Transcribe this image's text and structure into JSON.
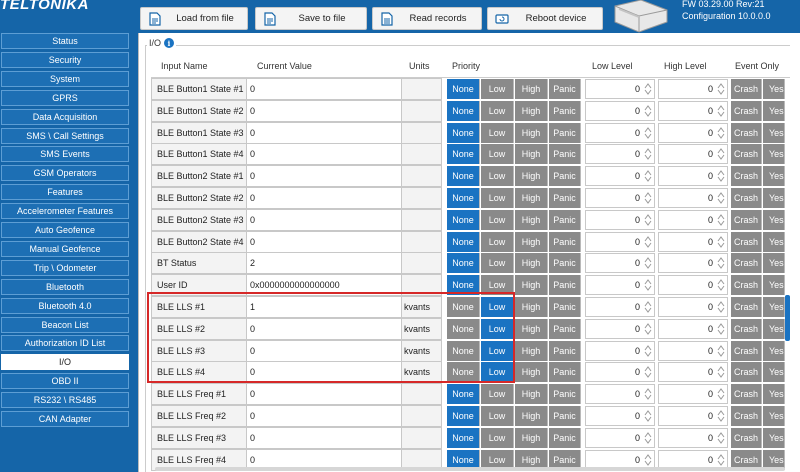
{
  "app": {
    "logo": "TELTONIKA",
    "fw_line": "FW  03.29.00 Rev:21",
    "config_line": "Configuration  10.0.0.0"
  },
  "toolbar": {
    "load_label": "Load from file",
    "save_label": "Save to file",
    "read_label": "Read records",
    "reboot_label": "Reboot device"
  },
  "sidebar": {
    "items": [
      "Status",
      "Security",
      "System",
      "GPRS",
      "Data Acquisition",
      "SMS \\ Call Settings",
      "SMS Events",
      "GSM Operators",
      "Features",
      "Accelerometer Features",
      "Auto Geofence",
      "Manual Geofence",
      "Trip \\ Odometer",
      "Bluetooth",
      "Bluetooth 4.0",
      "Beacon List",
      "Authorization ID List",
      "I/O",
      "OBD II",
      "RS232 \\ RS485",
      "CAN Adapter"
    ],
    "active_index": 17
  },
  "section": {
    "title": "I/O"
  },
  "table": {
    "headers": {
      "input_name": "Input Name",
      "current_value": "Current Value",
      "units": "Units",
      "priority": "Priority",
      "low_level": "Low Level",
      "high_level": "High Level",
      "event_only": "Event Only"
    },
    "priority_options": [
      "None",
      "Low",
      "High",
      "Panic"
    ],
    "event_options": [
      "Crash",
      "Yes"
    ],
    "rows": [
      {
        "name": "BLE Button1 State #1",
        "value": "0",
        "units": "",
        "priority": "None",
        "low": "0",
        "high": "0"
      },
      {
        "name": "BLE Button1 State #2",
        "value": "0",
        "units": "",
        "priority": "None",
        "low": "0",
        "high": "0"
      },
      {
        "name": "BLE Button1 State #3",
        "value": "0",
        "units": "",
        "priority": "None",
        "low": "0",
        "high": "0"
      },
      {
        "name": "BLE Button1 State #4",
        "value": "0",
        "units": "",
        "priority": "None",
        "low": "0",
        "high": "0"
      },
      {
        "name": "BLE Button2 State #1",
        "value": "0",
        "units": "",
        "priority": "None",
        "low": "0",
        "high": "0"
      },
      {
        "name": "BLE Button2 State #2",
        "value": "0",
        "units": "",
        "priority": "None",
        "low": "0",
        "high": "0"
      },
      {
        "name": "BLE Button2 State #3",
        "value": "0",
        "units": "",
        "priority": "None",
        "low": "0",
        "high": "0"
      },
      {
        "name": "BLE Button2 State #4",
        "value": "0",
        "units": "",
        "priority": "None",
        "low": "0",
        "high": "0"
      },
      {
        "name": "BT Status",
        "value": "2",
        "units": "",
        "priority": "None",
        "low": "0",
        "high": "0"
      },
      {
        "name": "User ID",
        "value": "0x0000000000000000",
        "units": "",
        "priority": "None",
        "low": "0",
        "high": "0"
      },
      {
        "name": "BLE LLS #1",
        "value": "1",
        "units": "kvants",
        "priority": "Low",
        "low": "0",
        "high": "0"
      },
      {
        "name": "BLE LLS #2",
        "value": "0",
        "units": "kvants",
        "priority": "Low",
        "low": "0",
        "high": "0"
      },
      {
        "name": "BLE LLS #3",
        "value": "0",
        "units": "kvants",
        "priority": "Low",
        "low": "0",
        "high": "0"
      },
      {
        "name": "BLE LLS #4",
        "value": "0",
        "units": "kvants",
        "priority": "Low",
        "low": "0",
        "high": "0"
      },
      {
        "name": "BLE LLS Freq #1",
        "value": "0",
        "units": "",
        "priority": "None",
        "low": "0",
        "high": "0"
      },
      {
        "name": "BLE LLS Freq #2",
        "value": "0",
        "units": "",
        "priority": "None",
        "low": "0",
        "high": "0"
      },
      {
        "name": "BLE LLS Freq #3",
        "value": "0",
        "units": "",
        "priority": "None",
        "low": "0",
        "high": "0"
      },
      {
        "name": "BLE LLS Freq #4",
        "value": "0",
        "units": "",
        "priority": "None",
        "low": "0",
        "high": "0"
      }
    ]
  },
  "colors": {
    "brand_blue": "#1565a8",
    "selected_blue": "#1a73c2",
    "unselected_grey": "#8a8a8a",
    "highlight_red": "#d62828"
  }
}
